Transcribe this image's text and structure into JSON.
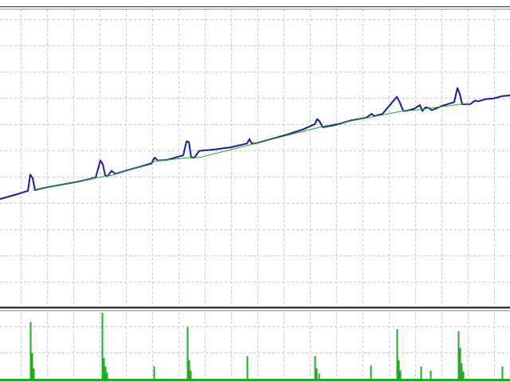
{
  "chart_data": [
    {
      "type": "line",
      "panel": "balance",
      "title": "",
      "xlabel": "",
      "ylabel": "",
      "grid": true,
      "xlim": [
        0,
        640
      ],
      "ylim": [
        0,
        400
      ],
      "series": [
        {
          "color": "#1a1a9e",
          "x": [
            0,
            20,
            35,
            38,
            41,
            44,
            47,
            60,
            80,
            100,
            120,
            126,
            129,
            132,
            135,
            140,
            145,
            160,
            180,
            190,
            194,
            198,
            210,
            230,
            234,
            237,
            240,
            244,
            250,
            270,
            290,
            310,
            313,
            316,
            320,
            340,
            360,
            380,
            395,
            398,
            401,
            405,
            420,
            440,
            460,
            466,
            470,
            480,
            498,
            502,
            506,
            510,
            520,
            527,
            530,
            534,
            538,
            542,
            555,
            570,
            574,
            577,
            580,
            584,
            590,
            596,
            600,
            610,
            620,
            630,
            640
          ],
          "values": [
            144,
            150,
            155,
            177,
            172,
            156,
            157,
            160,
            164,
            168,
            173,
            196,
            191,
            176,
            175,
            182,
            178,
            183,
            189,
            192,
            200,
            196,
            197,
            203,
            222,
            221,
            200,
            200,
            209,
            211,
            214,
            219,
            225,
            219,
            219,
            225,
            231,
            238,
            245,
            252,
            249,
            241,
            244,
            250,
            254,
            259,
            256,
            259,
            282,
            274,
            263,
            263,
            266,
            271,
            263,
            268,
            267,
            264,
            270,
            275,
            294,
            286,
            272,
            272,
            272,
            277,
            276,
            279,
            280,
            283,
            284
          ]
        },
        {
          "color": "#22aa22",
          "x": [
            41,
            47,
            132,
            140,
            198,
            210,
            240,
            250,
            401,
            405,
            506,
            520,
            577,
            590
          ],
          "values": [
            156,
            157,
            175,
            176,
            196,
            197,
            200,
            200,
            241,
            242,
            263,
            264,
            272,
            272
          ]
        }
      ]
    },
    {
      "type": "bar",
      "panel": "volume",
      "title": "",
      "xlabel": "",
      "ylabel": "",
      "grid": true,
      "ylim": [
        0,
        60
      ],
      "color": "#22aa22",
      "x": [
        38,
        40,
        42,
        128,
        130,
        132,
        134,
        193,
        235,
        237,
        239,
        310,
        395,
        397,
        400,
        465,
        498,
        500,
        502,
        528,
        540,
        575,
        577,
        579,
        581,
        630
      ],
      "values": [
        55,
        25,
        10,
        64,
        20,
        12,
        6,
        12,
        50,
        18,
        8,
        22,
        22,
        10,
        5,
        13,
        48,
        18,
        8,
        12,
        8,
        46,
        30,
        15,
        7,
        12
      ]
    }
  ]
}
